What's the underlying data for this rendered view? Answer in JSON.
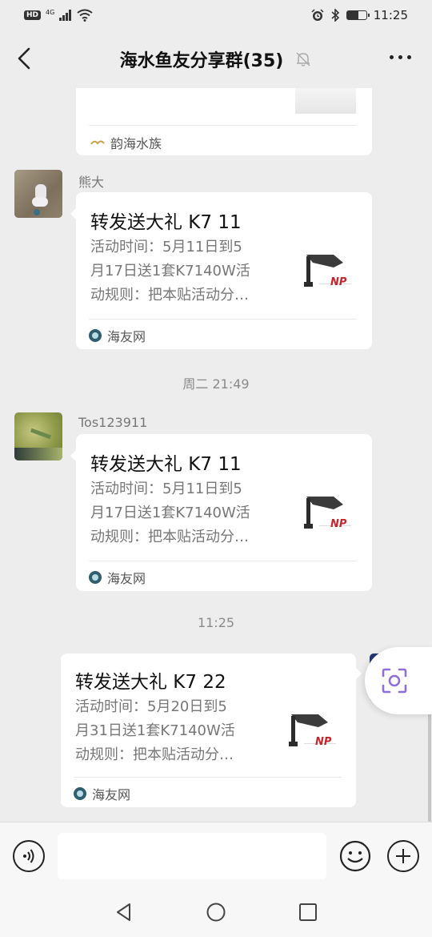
{
  "status_bar": {
    "hd": "HD",
    "network": "4G",
    "time": "11:25",
    "battery_level": 0.6
  },
  "nav": {
    "title": "海水鱼友分享群(35)",
    "icons": {
      "back": "chevron-left-icon",
      "mute": "bell-muted-icon",
      "more": "more-dots-icon"
    }
  },
  "messages": [
    {
      "type": "partial-card",
      "source": "韵海水族"
    },
    {
      "type": "link-card",
      "sender": "熊大",
      "title": "转发送大礼 K7 11",
      "desc_lines": [
        "活动时间：5月11日到5",
        "月17日送1套K7140W活",
        "动规则：把本贴活动分…"
      ],
      "thumb_text": "NP",
      "source": "海友网"
    },
    {
      "type": "time",
      "text": "周二 21:49"
    },
    {
      "type": "link-card",
      "sender": "Tos123911",
      "title": "转发送大礼 K7 11",
      "desc_lines": [
        "活动时间：5月11日到5",
        "月17日送1套K7140W活",
        "动规则：把本贴活动分…"
      ],
      "thumb_text": "NP",
      "source": "海友网"
    },
    {
      "type": "time",
      "text": "11:25"
    },
    {
      "type": "link-card",
      "sender": "",
      "title": "转发送大礼 K7 22",
      "desc_lines": [
        "活动时间：5月20日到5",
        "月31日送1套K7140W活",
        "动规则：把本贴活动分…"
      ],
      "thumb_text": "NP",
      "source": "海友网"
    }
  ],
  "input_bar": {
    "placeholder": "",
    "icons": {
      "voice": "voice-icon",
      "emoji": "emoji-icon",
      "plus": "plus-icon"
    }
  },
  "system_nav": {
    "icons": {
      "back": "triangle-back-icon",
      "home": "circle-home-icon",
      "recents": "square-recents-icon"
    }
  },
  "floating": {
    "icon": "lens-scan-icon"
  }
}
